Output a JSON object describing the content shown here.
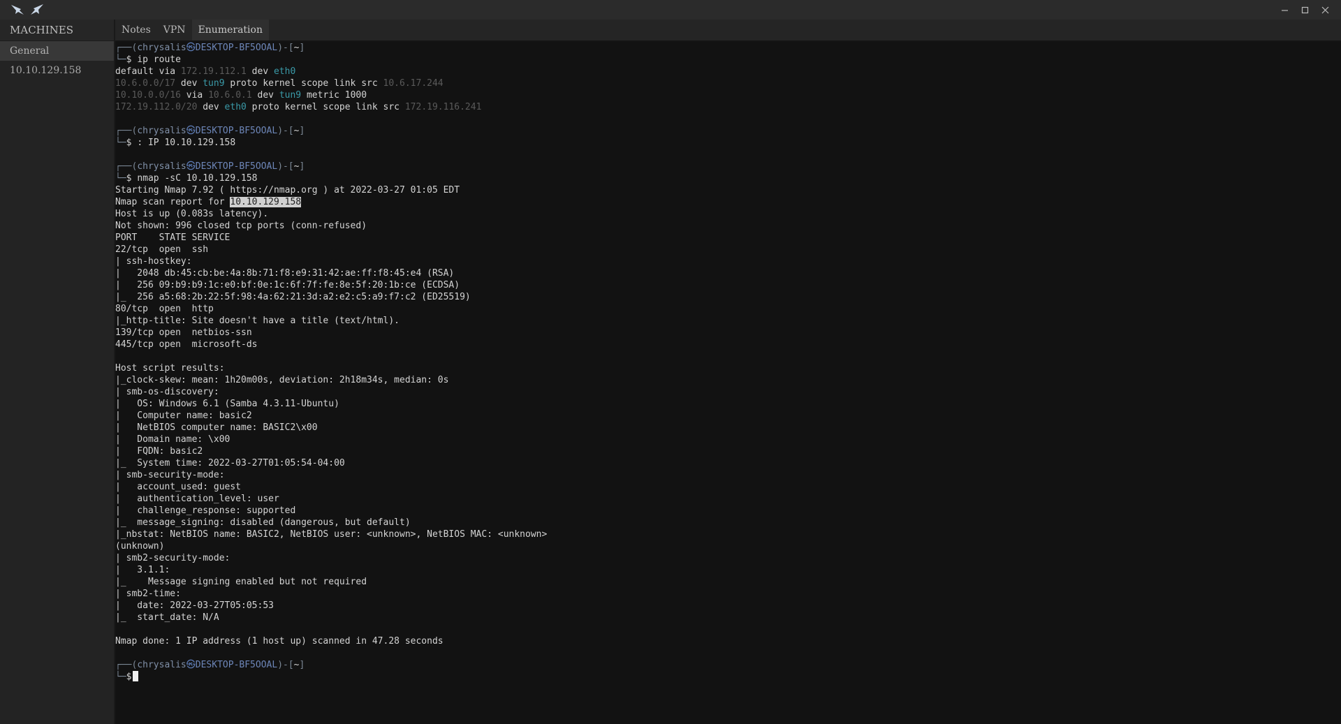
{
  "window": {
    "minimize_icon": "minimize-icon",
    "maximize_icon": "maximize-icon",
    "close_icon": "close-icon"
  },
  "sidebar": {
    "header": "MACHINES",
    "items": [
      {
        "label": "General",
        "active": true
      },
      {
        "label": "10.10.129.158",
        "active": false
      }
    ]
  },
  "tabs": [
    {
      "label": "Notes",
      "active": false
    },
    {
      "label": "VPN",
      "active": false
    },
    {
      "label": "Enumeration",
      "active": true
    }
  ],
  "prompt": {
    "user": "chrysalis",
    "host": "DESKTOP-BF5OOAL",
    "dir": "~",
    "symbol": "$"
  },
  "terminal": {
    "cmd1": "ip route",
    "route1": {
      "a": "default via ",
      "ip": "172.19.112.1",
      "b": " dev ",
      "dev": "eth0"
    },
    "route2": {
      "net": "10.6.0.0/17",
      "b": " dev ",
      "dev": "tun9",
      "c": " proto kernel scope link src ",
      "src": "10.6.17.244"
    },
    "route3": {
      "net": "10.10.0.0/16",
      "b": " via ",
      "via": "10.6.0.1",
      "c": " dev ",
      "dev": "tun9",
      "d": " metric 1000"
    },
    "route4": {
      "net": "172.19.112.0/20",
      "b": " dev ",
      "dev": "eth0",
      "c": " proto kernel scope link src ",
      "src": "172.19.116.241"
    },
    "cmd2": ": IP 10.10.129.158",
    "cmd3": "nmap -sC 10.10.129.158",
    "nmap_start": "Starting Nmap 7.92 ( https://nmap.org ) at 2022-03-27 01:05 EDT",
    "scan_report_prefix": "Nmap scan report for ",
    "scan_report_ip": "10.10.129.158",
    "output": [
      "Host is up (0.083s latency).",
      "Not shown: 996 closed tcp ports (conn-refused)",
      "PORT    STATE SERVICE",
      "22/tcp  open  ssh",
      "| ssh-hostkey:",
      "|   2048 db:45:cb:be:4a:8b:71:f8:e9:31:42:ae:ff:f8:45:e4 (RSA)",
      "|   256 09:b9:b9:1c:e0:bf:0e:1c:6f:7f:fe:8e:5f:20:1b:ce (ECDSA)",
      "|_  256 a5:68:2b:22:5f:98:4a:62:21:3d:a2:e2:c5:a9:f7:c2 (ED25519)",
      "80/tcp  open  http",
      "|_http-title: Site doesn't have a title (text/html).",
      "139/tcp open  netbios-ssn",
      "445/tcp open  microsoft-ds",
      "",
      "Host script results:",
      "|_clock-skew: mean: 1h20m00s, deviation: 2h18m34s, median: 0s",
      "| smb-os-discovery:",
      "|   OS: Windows 6.1 (Samba 4.3.11-Ubuntu)",
      "|   Computer name: basic2",
      "|   NetBIOS computer name: BASIC2\\x00",
      "|   Domain name: \\x00",
      "|   FQDN: basic2",
      "|_  System time: 2022-03-27T01:05:54-04:00",
      "| smb-security-mode:",
      "|   account_used: guest",
      "|   authentication_level: user",
      "|   challenge_response: supported",
      "|_  message_signing: disabled (dangerous, but default)",
      "|_nbstat: NetBIOS name: BASIC2, NetBIOS user: <unknown>, NetBIOS MAC: <unknown>",
      "(unknown)",
      "| smb2-security-mode:",
      "|   3.1.1:",
      "|_    Message signing enabled but not required",
      "| smb2-time:",
      "|   date: 2022-03-27T05:05:53",
      "|_  start_date: N/A",
      "",
      "Nmap done: 1 IP address (1 host up) scanned in 47.28 seconds"
    ]
  }
}
